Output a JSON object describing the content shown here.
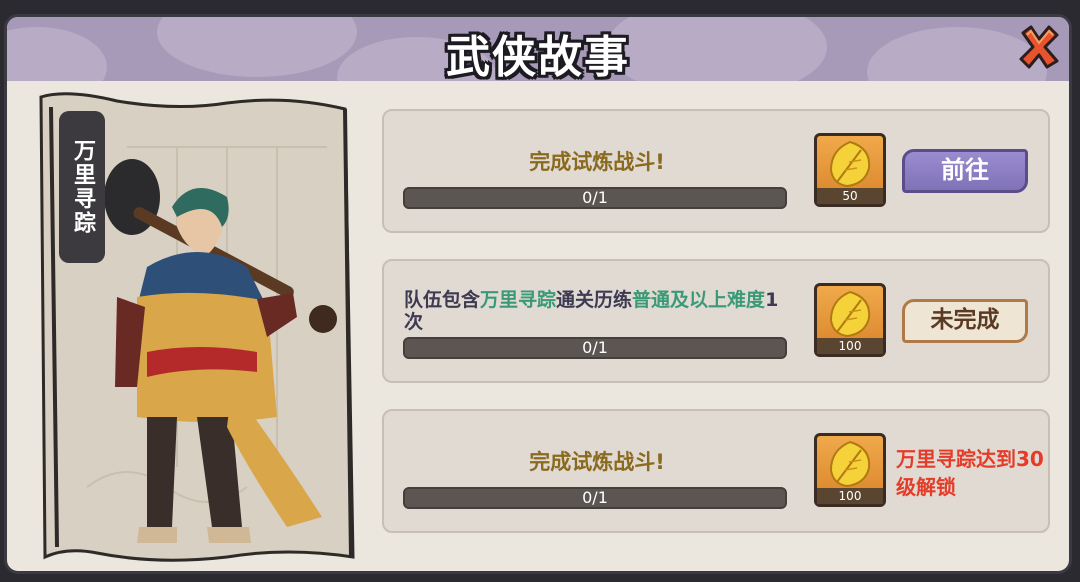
{
  "title": "武侠故事",
  "character": {
    "name": "万里寻踪"
  },
  "tasks": [
    {
      "text": "完成试炼战斗!",
      "progress_text": "0/1",
      "progress": 0,
      "reward_qty": "50",
      "action_label": "前往"
    },
    {
      "text_parts": [
        "队伍包含",
        "万里寻踪",
        "通关历练",
        "普通及以上难度",
        "1次"
      ],
      "progress_text": "0/1",
      "progress": 0,
      "reward_qty": "100",
      "status_label": "未完成"
    },
    {
      "text": "完成试炼战斗!",
      "progress_text": "0/1",
      "progress": 0,
      "reward_qty": "100",
      "lock_text": "万里寻踪达到30级解锁"
    }
  ],
  "colors": {
    "header": "#a79ab8",
    "highlight": "#3a9a78",
    "lock_red": "#e53c2a",
    "go_button": "#8072b8"
  },
  "icons": [
    "close-icon",
    "golden-leaf-icon"
  ]
}
